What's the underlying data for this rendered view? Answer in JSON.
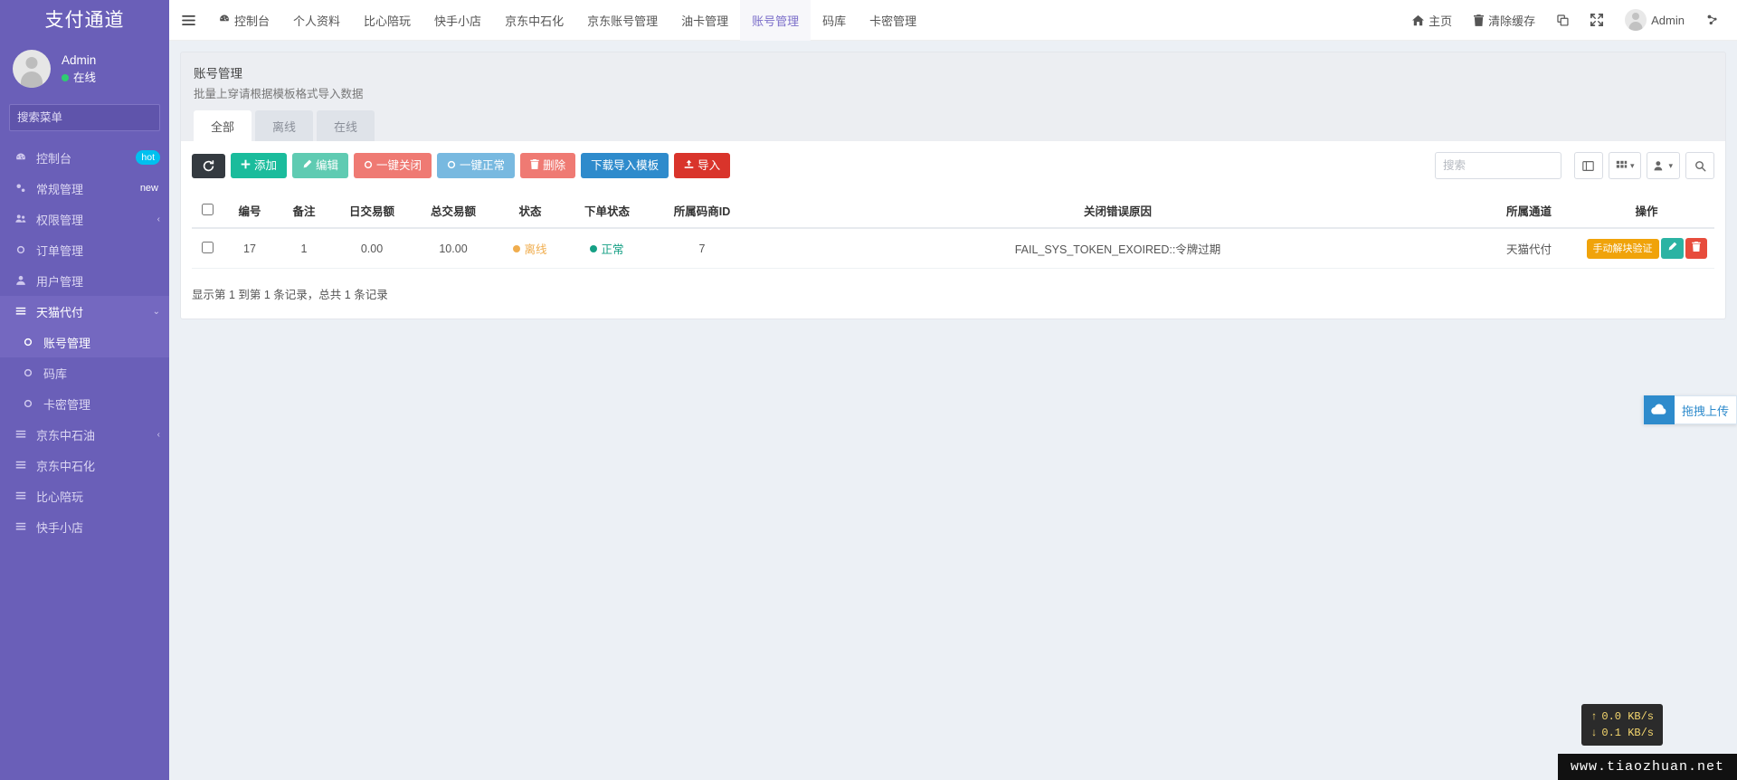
{
  "sidebar": {
    "brand": "支付通道",
    "user": {
      "name": "Admin",
      "status": "在线"
    },
    "search": {
      "placeholder": "搜索菜单",
      "value": "",
      "icon": "search-icon"
    },
    "items": [
      {
        "label": "控制台",
        "icon": "dashboard-icon",
        "badge": "hot",
        "badge_type": "hot",
        "state": ""
      },
      {
        "label": "常规管理",
        "icon": "cogs-icon",
        "badge": "new",
        "badge_type": "new",
        "state": ""
      },
      {
        "label": "权限管理",
        "icon": "users-icon",
        "badge": "",
        "caret": "‹",
        "state": ""
      },
      {
        "label": "订单管理",
        "icon": "circle-icon",
        "badge": "",
        "state": ""
      },
      {
        "label": "用户管理",
        "icon": "user-icon",
        "badge": "",
        "state": ""
      },
      {
        "label": "天猫代付",
        "icon": "list-icon",
        "badge": "",
        "caret": "⌄",
        "state": "open"
      },
      {
        "label": "账号管理",
        "icon": "circle-icon",
        "badge": "",
        "state": "active",
        "child": true
      },
      {
        "label": "码库",
        "icon": "circle-icon",
        "badge": "",
        "state": "",
        "child": true
      },
      {
        "label": "卡密管理",
        "icon": "circle-icon",
        "badge": "",
        "state": "",
        "child": true
      },
      {
        "label": "京东中石油",
        "icon": "list-icon",
        "badge": "",
        "caret": "‹",
        "state": ""
      },
      {
        "label": "京东中石化",
        "icon": "list-icon",
        "badge": "",
        "state": ""
      },
      {
        "label": "比心陪玩",
        "icon": "list-icon",
        "badge": "",
        "state": ""
      },
      {
        "label": "快手小店",
        "icon": "list-icon",
        "badge": "",
        "state": ""
      }
    ]
  },
  "topbar": {
    "hamburger_icon": "hamburger-icon",
    "nav": [
      {
        "label": "控制台",
        "icon": "dashboard-icon",
        "active": false
      },
      {
        "label": "个人资料",
        "icon": "",
        "active": false
      },
      {
        "label": "比心陪玩",
        "icon": "",
        "active": false
      },
      {
        "label": "快手小店",
        "icon": "",
        "active": false
      },
      {
        "label": "京东中石化",
        "icon": "",
        "active": false
      },
      {
        "label": "京东账号管理",
        "icon": "",
        "active": false
      },
      {
        "label": "油卡管理",
        "icon": "",
        "active": false
      },
      {
        "label": "账号管理",
        "icon": "",
        "active": true
      },
      {
        "label": "码库",
        "icon": "",
        "active": false
      },
      {
        "label": "卡密管理",
        "icon": "",
        "active": false
      }
    ],
    "right": {
      "home": "主页",
      "home_icon": "home-icon",
      "clear_cache": "清除缓存",
      "clear_cache_icon": "trash-icon",
      "copy_icon": "clone-icon",
      "fullscreen_icon": "expand-icon",
      "user_name": "Admin",
      "avatar_icon": "avatar",
      "settings_icon": "cogs-icon"
    }
  },
  "page": {
    "title": "账号管理",
    "subtitle": "批量上穿请根据模板格式导入数据",
    "tabs": [
      {
        "label": "全部",
        "active": true
      },
      {
        "label": "离线",
        "active": false
      },
      {
        "label": "在线",
        "active": false
      }
    ]
  },
  "toolbar": {
    "refresh_icon": "refresh-icon",
    "buttons": [
      {
        "label": "添加",
        "icon": "plus-icon",
        "style": "green"
      },
      {
        "label": "编辑",
        "icon": "pencil-icon",
        "style": "teal"
      },
      {
        "label": "一键关闭",
        "icon": "circle-icon",
        "style": "red"
      },
      {
        "label": "一键正常",
        "icon": "circle-icon",
        "style": "blue-l"
      },
      {
        "label": "删除",
        "icon": "trash-icon",
        "style": "salmon"
      },
      {
        "label": "下载导入模板",
        "icon": "",
        "style": "blue"
      },
      {
        "label": "导入",
        "icon": "upload-icon",
        "style": "danger"
      }
    ],
    "search_placeholder": "搜索",
    "search_value": "",
    "columns_icon": "columns-icon",
    "grid_icon": "grid-icon",
    "export_icon": "export-icon",
    "search_icon": "search-icon"
  },
  "table": {
    "columns": [
      "",
      "编号",
      "备注",
      "日交易额",
      "总交易额",
      "状态",
      "下单状态",
      "所属码商ID",
      "关闭错误原因",
      "所属通道",
      "操作"
    ],
    "rows": [
      {
        "id": "17",
        "remark": "1",
        "daily_amount": "0.00",
        "total_amount": "10.00",
        "status": "离线",
        "status_type": "offline",
        "order_status": "正常",
        "order_status_type": "normal",
        "merchant_id": "7",
        "error_reason": "FAIL_SYS_TOKEN_EXOIRED::令牌过期",
        "channel": "天猫代付",
        "actions": [
          {
            "label": "手动解块验证",
            "style": "orange",
            "icon": ""
          },
          {
            "label": "",
            "style": "cyan",
            "icon": "pencil-icon"
          },
          {
            "label": "",
            "style": "red",
            "icon": "trash-icon"
          }
        ]
      }
    ],
    "info": "显示第 1 到第 1 条记录，总共 1 条记录"
  },
  "floating": {
    "upload": {
      "label": "拖拽上传",
      "icon": "cloud-upload-icon"
    },
    "netmon": {
      "up": "0.0 KB/s",
      "down": "0.1 KB/s",
      "up_icon": "↑",
      "down_icon": "↓"
    },
    "watermark": "www.tiaozhuan.net"
  },
  "colors": {
    "sidebar_bg": "#6a5fb8",
    "accent": "#7b6ec9",
    "online": "#2ecc71",
    "offline": "#f0ad4e",
    "normal": "#16a085"
  }
}
